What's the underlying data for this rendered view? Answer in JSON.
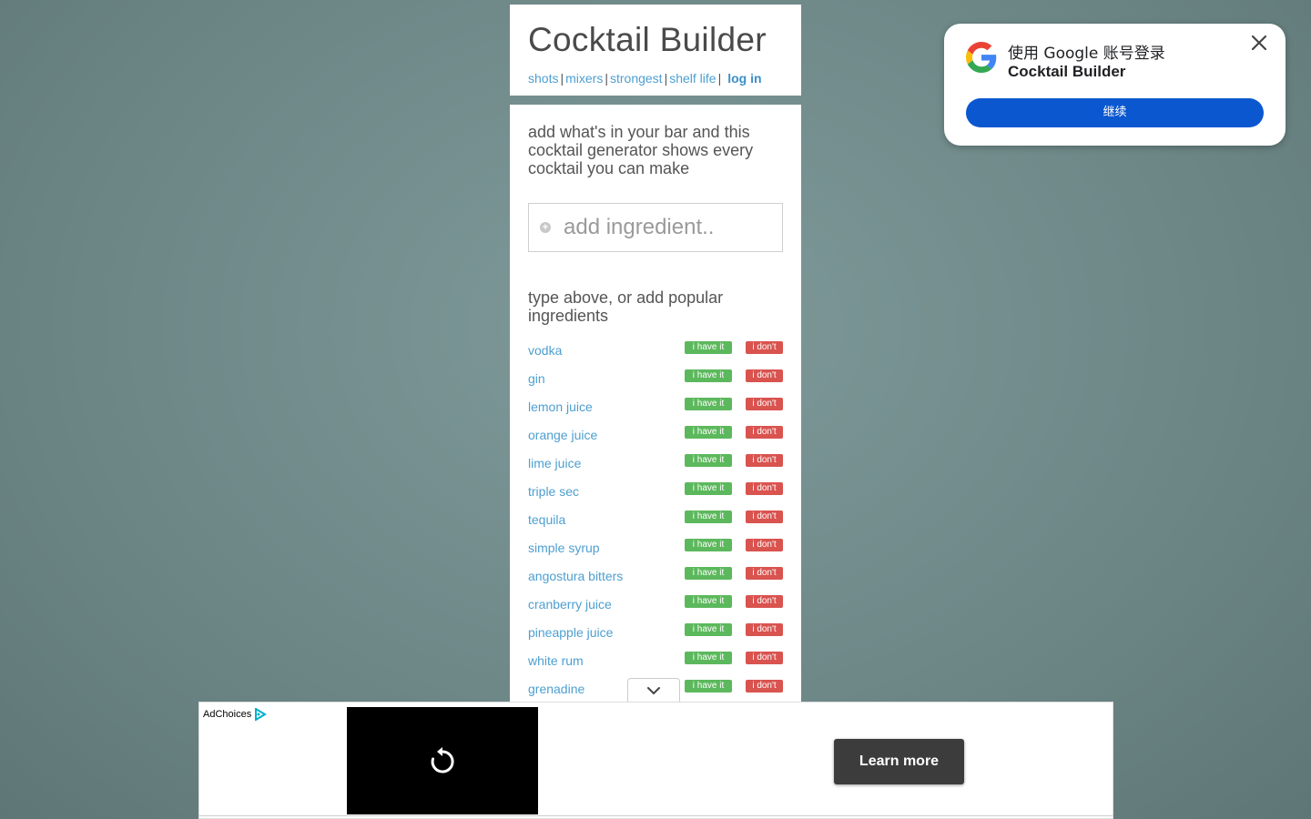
{
  "header": {
    "title": "Cocktail Builder",
    "nav": {
      "shots": "shots",
      "mixers": "mixers",
      "strongest": "strongest",
      "shelf_life": "shelf life",
      "login": "log in",
      "separator": "|"
    }
  },
  "main": {
    "intro": "add what's in your bar and this cocktail generator shows every cocktail you can make",
    "search": {
      "placeholder": "add ingredient.."
    },
    "popular_heading": "type above, or add popular ingredients",
    "have_label": "i have it",
    "dont_label": "i don't",
    "ingredients": [
      "vodka",
      "gin",
      "lemon juice",
      "orange juice",
      "lime juice",
      "triple sec",
      "tequila",
      "simple syrup",
      "angostura bitters",
      "cranberry juice",
      "pineapple juice",
      "white rum",
      "grenadine"
    ]
  },
  "google_popup": {
    "title": "使用 Google 账号登录",
    "site": "Cocktail Builder",
    "continue_label": "继续",
    "close_icon": "close-icon",
    "logo_icon": "google-logo-icon",
    "button_color": "#0b57d0"
  },
  "ad": {
    "adchoices_label": "AdChoices",
    "learn_more_label": "Learn more",
    "replay_icon": "replay-icon"
  },
  "colors": {
    "link": "#4d9fd0",
    "have": "#5cb85c",
    "dont": "#d9534f"
  }
}
